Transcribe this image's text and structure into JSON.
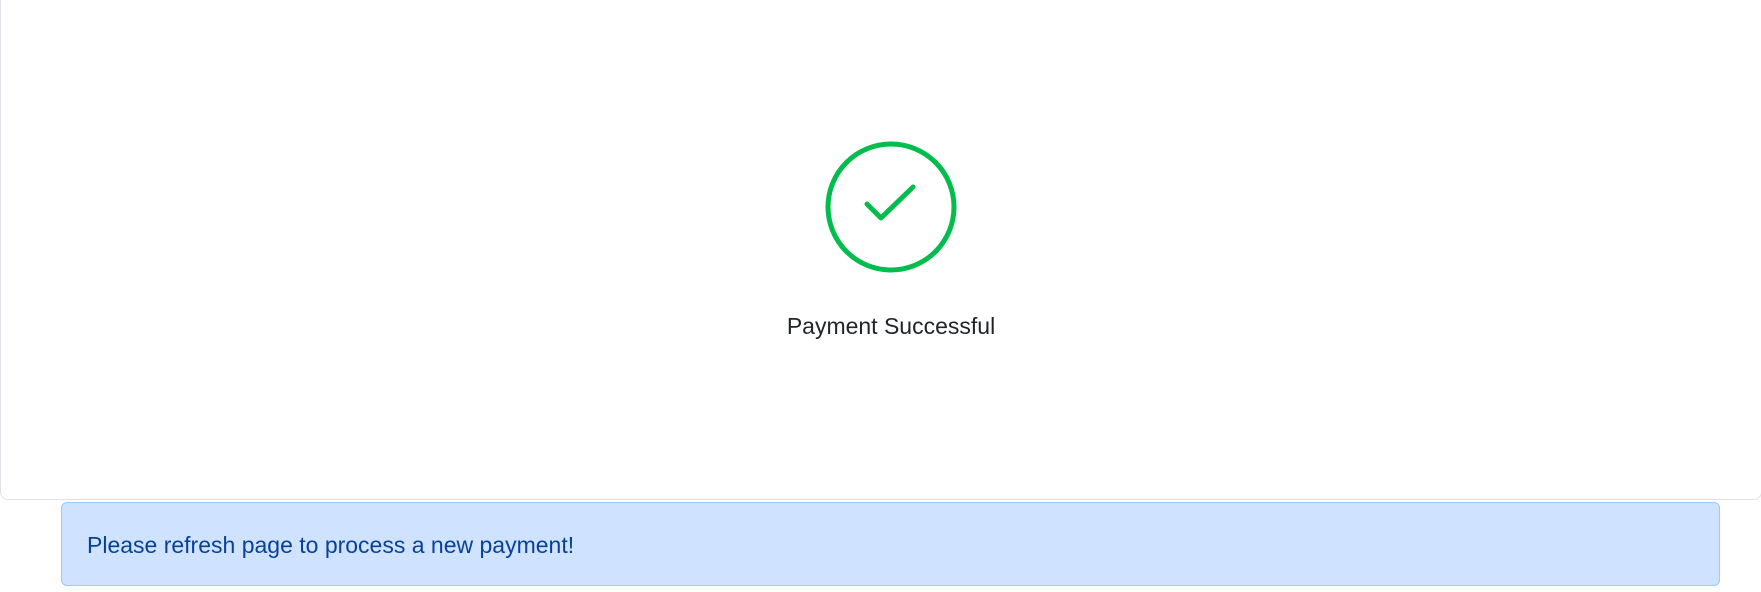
{
  "status": {
    "icon": "check-circle-icon",
    "message": "Payment Successful",
    "color": "#00bd4e"
  },
  "alert": {
    "message": "Please refresh page to process a new payment!",
    "type": "info",
    "background": "#cfe2ff",
    "text_color": "#084298"
  }
}
